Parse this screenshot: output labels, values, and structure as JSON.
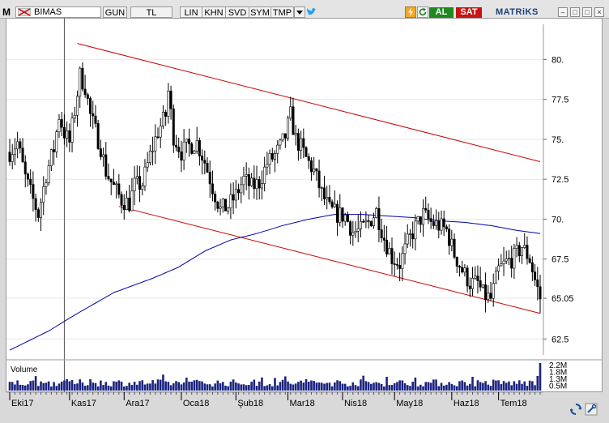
{
  "toolbar": {
    "logo": "M",
    "symbol": "BIMAS",
    "period": "GUN",
    "currency": "TL",
    "buttons": [
      "LIN",
      "KHN",
      "SVD",
      "SYM",
      "TMP"
    ],
    "buy_label": "AL",
    "sell_label": "SAT",
    "brand": "MATRiKS",
    "icons": [
      "flag-icon",
      "dropdown-arrow-icon",
      "twitter-icon",
      "lightning-icon",
      "refresh-icon"
    ]
  },
  "chart_data": {
    "type": "candlestick",
    "symbol": "BIMAS",
    "y_ticks": [
      "80.",
      "77.5",
      "75.",
      "72.5",
      "70.",
      "67.5",
      "65.05",
      "62.5"
    ],
    "ylim": [
      61.5,
      82.2
    ],
    "x_ticks": [
      "Eki17",
      "Kas17",
      "Ara17",
      "Oca18",
      "Şub18",
      "Mar18",
      "Nis18",
      "May18",
      "Haz18",
      "Tem18"
    ],
    "x_tick_index": [
      0,
      23,
      44,
      66,
      87,
      107,
      128,
      148,
      170,
      188
    ],
    "last_price": 65.05,
    "anchors": [
      [
        0,
        74.2
      ],
      [
        3,
        74.8
      ],
      [
        6,
        72.6
      ],
      [
        9,
        71.2
      ],
      [
        11,
        70.3
      ],
      [
        14,
        72.8
      ],
      [
        17,
        74.4
      ],
      [
        19,
        76.5
      ],
      [
        21,
        75.4
      ],
      [
        23,
        74.8
      ],
      [
        25,
        76.8
      ],
      [
        27,
        79.0
      ],
      [
        29,
        78.3
      ],
      [
        31,
        76.5
      ],
      [
        33,
        75.5
      ],
      [
        35,
        74.5
      ],
      [
        37,
        73.0
      ],
      [
        40,
        72.0
      ],
      [
        43,
        71.2
      ],
      [
        46,
        71.0
      ],
      [
        48,
        72.1
      ],
      [
        51,
        72.2
      ],
      [
        54,
        74.0
      ],
      [
        57,
        75.5
      ],
      [
        60,
        76.5
      ],
      [
        61,
        78.0
      ],
      [
        63,
        75.2
      ],
      [
        66,
        74.2
      ],
      [
        69,
        74.6
      ],
      [
        72,
        74.8
      ],
      [
        75,
        73.6
      ],
      [
        78,
        72.0
      ],
      [
        81,
        70.6
      ],
      [
        84,
        70.8
      ],
      [
        87,
        71.5
      ],
      [
        90,
        72.5
      ],
      [
        93,
        72.0
      ],
      [
        96,
        72.3
      ],
      [
        99,
        73.5
      ],
      [
        102,
        74.0
      ],
      [
        104,
        74.5
      ],
      [
        106,
        75.2
      ],
      [
        108,
        76.5
      ],
      [
        110,
        75.0
      ],
      [
        112,
        74.5
      ],
      [
        114,
        73.8
      ],
      [
        117,
        73.0
      ],
      [
        120,
        71.6
      ],
      [
        123,
        70.6
      ],
      [
        126,
        70.3
      ],
      [
        129,
        70.2
      ],
      [
        132,
        69.2
      ],
      [
        135,
        69.3
      ],
      [
        138,
        69.8
      ],
      [
        141,
        70.5
      ],
      [
        144,
        68.8
      ],
      [
        147,
        67.6
      ],
      [
        150,
        67.2
      ],
      [
        153,
        68.5
      ],
      [
        156,
        69.5
      ],
      [
        159,
        70.3
      ],
      [
        162,
        69.8
      ],
      [
        165,
        69.6
      ],
      [
        168,
        69.3
      ],
      [
        171,
        67.8
      ],
      [
        174,
        66.8
      ],
      [
        177,
        66.0
      ],
      [
        180,
        66.0
      ],
      [
        182,
        65.3
      ],
      [
        185,
        65.0
      ],
      [
        188,
        66.8
      ],
      [
        191,
        67.3
      ],
      [
        194,
        67.6
      ],
      [
        197,
        68.3
      ],
      [
        200,
        67.5
      ],
      [
        202,
        66.2
      ],
      [
        204,
        65.05
      ]
    ],
    "ma_anchors": [
      [
        0,
        61.8
      ],
      [
        15,
        63.0
      ],
      [
        25,
        64.0
      ],
      [
        40,
        65.4
      ],
      [
        55,
        66.3
      ],
      [
        65,
        67.0
      ],
      [
        75,
        68.0
      ],
      [
        85,
        68.7
      ],
      [
        95,
        69.1
      ],
      [
        105,
        69.6
      ],
      [
        115,
        70.0
      ],
      [
        125,
        70.3
      ],
      [
        135,
        70.3
      ],
      [
        145,
        70.2
      ],
      [
        155,
        70.1
      ],
      [
        165,
        69.9
      ],
      [
        175,
        69.8
      ],
      [
        185,
        69.6
      ],
      [
        195,
        69.3
      ],
      [
        204,
        69.1
      ]
    ],
    "channel_upper": [
      [
        26,
        81.0
      ],
      [
        204,
        73.6
      ]
    ],
    "channel_lower": [
      [
        42,
        70.8
      ],
      [
        204,
        64.1
      ]
    ],
    "volume_label": "Volume",
    "volume_ticks": [
      "2.2M",
      "1.8M",
      "1.3M",
      "0.5M"
    ],
    "vline_index": 21,
    "colors": {
      "candle": "#000000",
      "ma": "#0000aa",
      "channel": "#cc0000",
      "volume": "#1a237e",
      "grid": "#e8e8e8"
    }
  }
}
